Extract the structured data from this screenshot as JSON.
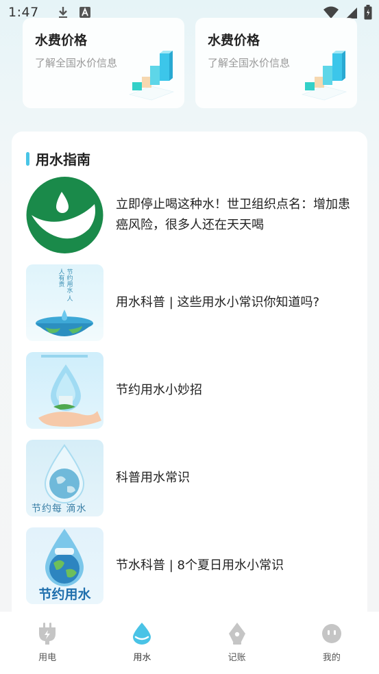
{
  "status_bar": {
    "time": "1:47"
  },
  "price_cards": [
    {
      "title": "水费价格",
      "subtitle": "了解全国水价信息"
    },
    {
      "title": "水费价格",
      "subtitle": "了解全国水价信息"
    }
  ],
  "guide": {
    "title": "用水指南",
    "articles": [
      {
        "title": "立即停止喝这种水！世卫组织点名：增加患癌风险，很多人还在天天喝"
      },
      {
        "title": "用水科普 | 这些用水小常识你知道吗?"
      },
      {
        "title": "节约用水小妙招"
      },
      {
        "title": "科普用水常识"
      },
      {
        "title": "节水科普 | 8个夏日用水小常识"
      }
    ],
    "thumb_text": {
      "a2_poster_text": "节约用水 人人有责",
      "a4_caption": "节约每 滴水",
      "a5_caption": "节约用水"
    }
  },
  "tabs": [
    {
      "label": "用电",
      "icon": "plug-icon",
      "active": false
    },
    {
      "label": "用水",
      "icon": "water-drop-icon",
      "active": true
    },
    {
      "label": "记账",
      "icon": "pen-nib-icon",
      "active": false
    },
    {
      "label": "我的",
      "icon": "face-icon",
      "active": false
    }
  ],
  "colors": {
    "accent": "#49c5e6",
    "logo_green": "#1a8a4a"
  }
}
